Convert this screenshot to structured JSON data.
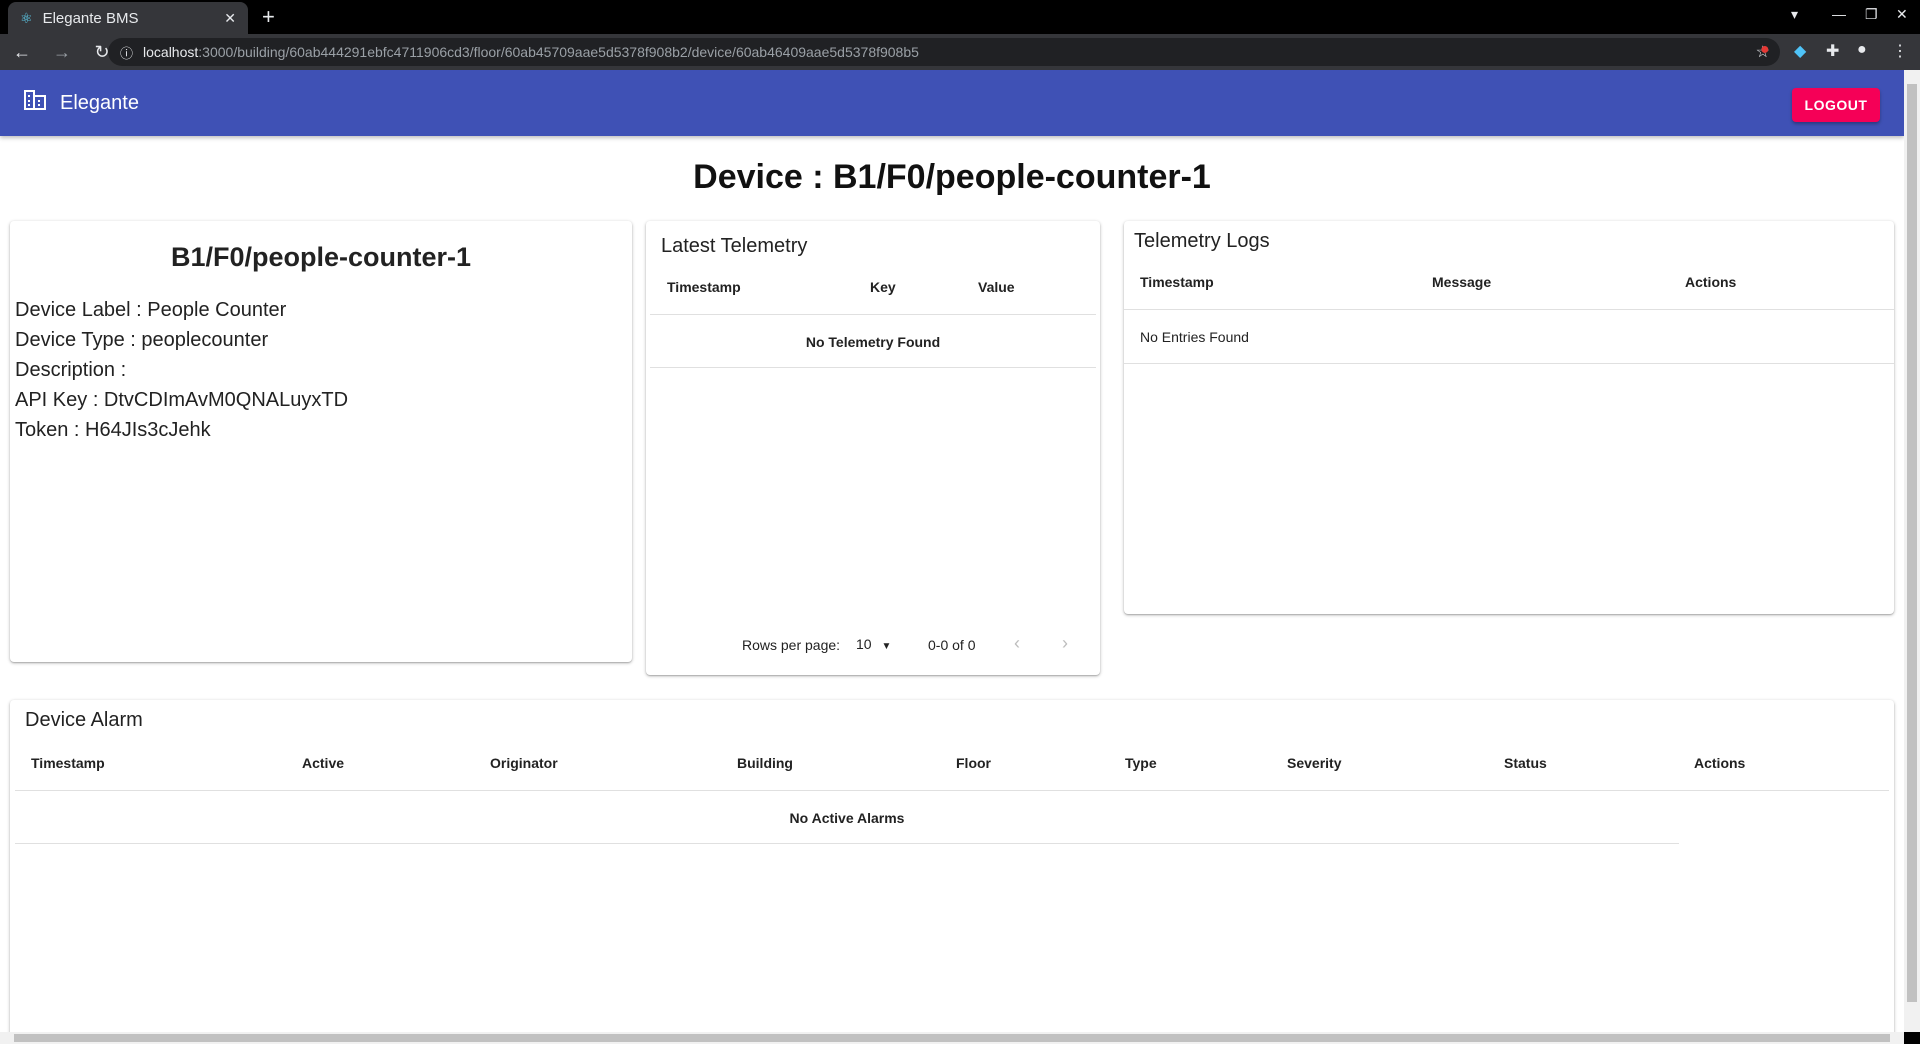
{
  "browser": {
    "tab_title": "Elegante BMS",
    "url_host": "localhost",
    "url_rest": ":3000/building/60ab444291ebfc4711906cd3/floor/60ab45709aae5d5378f908b2/device/60ab46409aae5d5378f908b5"
  },
  "app": {
    "brand": "Elegante",
    "logout_label": "LOGOUT",
    "accent_color": "#3f51b5",
    "logout_color": "#f50057"
  },
  "page_title": "Device : B1/F0/people-counter-1",
  "device_card": {
    "name": "B1/F0/people-counter-1",
    "label": "Device Label : People Counter",
    "type": "Device Type : peoplecounter",
    "description": "Description :",
    "api_key": "API Key : DtvCDImAvM0QNALuyxTD",
    "token": "Token : H64JIs3cJehk"
  },
  "latest_telemetry": {
    "title": "Latest Telemetry",
    "columns": [
      "Timestamp",
      "Key",
      "Value"
    ],
    "empty": "No Telemetry Found",
    "rows_per_page_label": "Rows per page:",
    "rows_per_page": "10",
    "range": "0-0 of 0"
  },
  "telemetry_logs": {
    "title": "Telemetry Logs",
    "columns": [
      "Timestamp",
      "Message",
      "Actions"
    ],
    "empty": "No Entries Found"
  },
  "device_alarm": {
    "title": "Device Alarm",
    "columns": [
      "Timestamp",
      "Active",
      "Originator",
      "Building",
      "Floor",
      "Type",
      "Severity",
      "Status",
      "Actions"
    ],
    "empty": "No Active Alarms"
  }
}
